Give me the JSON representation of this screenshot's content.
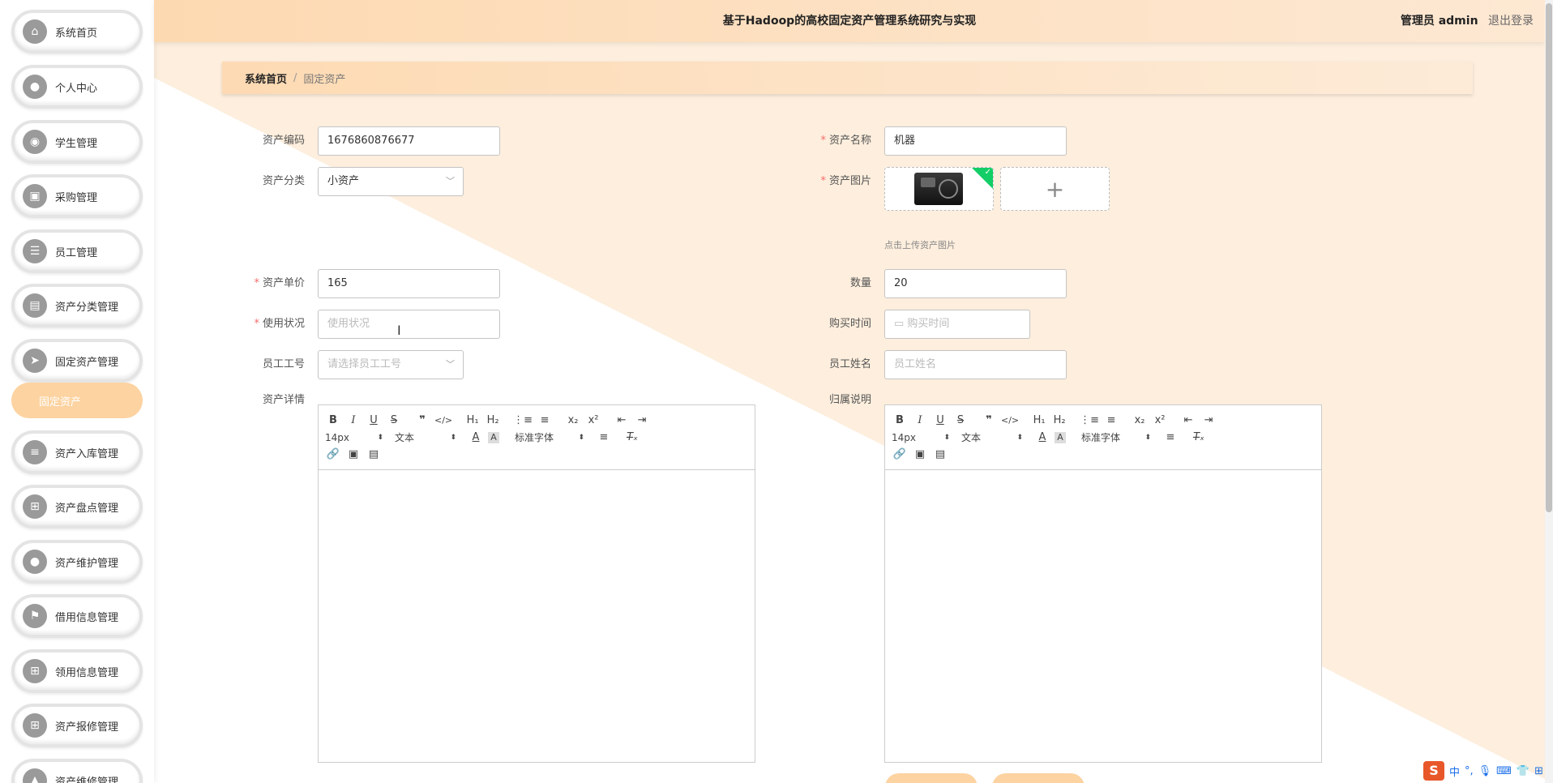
{
  "header": {
    "title": "基于Hadoop的高校固定资产管理系统研究与实现",
    "role": "管理员 admin",
    "logout": "退出登录"
  },
  "breadcrumb": {
    "home": "系统首页",
    "separator": "/",
    "current": "固定资产"
  },
  "sidebar": {
    "items": [
      {
        "label": "系统首页",
        "icon": "home-icon",
        "glyph": "⌂"
      },
      {
        "label": "个人中心",
        "icon": "user-icon",
        "glyph": "●"
      },
      {
        "label": "学生管理",
        "icon": "location-icon",
        "glyph": "◉"
      },
      {
        "label": "采购管理",
        "icon": "briefcase-icon",
        "glyph": "▣"
      },
      {
        "label": "员工管理",
        "icon": "list-icon",
        "glyph": "☰"
      },
      {
        "label": "资产分类管理",
        "icon": "printer-icon",
        "glyph": "▤"
      },
      {
        "label": "固定资产管理",
        "icon": "send-icon",
        "glyph": "➤"
      },
      {
        "label": "资产入库管理",
        "icon": "sliders-icon",
        "glyph": "≡"
      },
      {
        "label": "资产盘点管理",
        "icon": "grid-icon",
        "glyph": "⊞"
      },
      {
        "label": "资产维护管理",
        "icon": "person-icon",
        "glyph": "●"
      },
      {
        "label": "借用信息管理",
        "icon": "flag-icon",
        "glyph": "⚑"
      },
      {
        "label": "领用信息管理",
        "icon": "apps-icon",
        "glyph": "⊞"
      },
      {
        "label": "资产报修管理",
        "icon": "grid-icon",
        "glyph": "⊞"
      },
      {
        "label": "资产维修管理",
        "icon": "chart-icon",
        "glyph": "▲"
      }
    ],
    "sub_item": "固定资产"
  },
  "form": {
    "asset_code": {
      "label": "资产编码",
      "value": "1676860876677"
    },
    "asset_name": {
      "label": "资产名称",
      "value": "机器"
    },
    "asset_category": {
      "label": "资产分类",
      "value": "小资产"
    },
    "asset_image": {
      "label": "资产图片",
      "tip": "点击上传资产图片",
      "add": "+"
    },
    "unit_price": {
      "label": "资产单价",
      "value": "165"
    },
    "quantity": {
      "label": "数量",
      "value": "20"
    },
    "usage_status": {
      "label": "使用状况",
      "placeholder": "使用状况"
    },
    "purchase_time": {
      "label": "购买时间",
      "placeholder": "购买时间"
    },
    "employee_no": {
      "label": "员工工号",
      "placeholder": "请选择员工工号"
    },
    "employee_name": {
      "label": "员工姓名",
      "placeholder": "员工姓名"
    },
    "asset_detail": {
      "label": "资产详情"
    },
    "ownership": {
      "label": "归属说明"
    }
  },
  "editor": {
    "font_size": "14px",
    "text_type": "文本",
    "font_family": "标准字体"
  },
  "ime": {
    "lang": "中",
    "punct": "°,"
  }
}
